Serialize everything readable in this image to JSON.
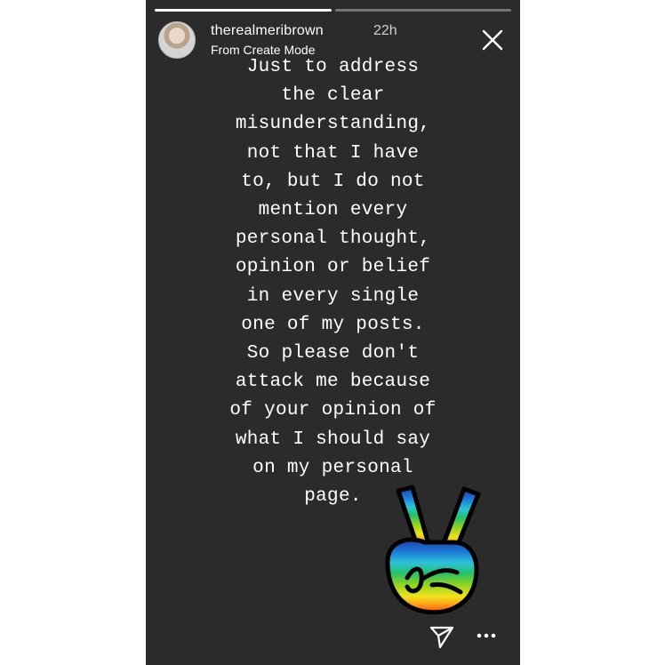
{
  "story": {
    "progress_segments": [
      {
        "state": "complete",
        "fill_fraction": 1.0
      },
      {
        "state": "current",
        "fill_fraction": 0.0
      }
    ],
    "header": {
      "username": "therealmeribrown",
      "timestamp": "22h",
      "subtitle": "From Create Mode"
    },
    "message": "Just to address\nthe clear\nmisunderstanding,\nnot that I have\nto, but I do not\nmention every\npersonal thought,\nopinion or belief\nin every single\none of my posts.\nSo please don't\nattack me because\nof your opinion of\nwhat I should say\non my personal\npage.",
    "sticker": "rainbow-peace-sign-hand",
    "icons": {
      "close": "close-icon",
      "send": "paper-plane-icon",
      "more": "more-options-icon"
    },
    "colors": {
      "background": "#2b2b2b",
      "text": "#ffffff"
    }
  }
}
